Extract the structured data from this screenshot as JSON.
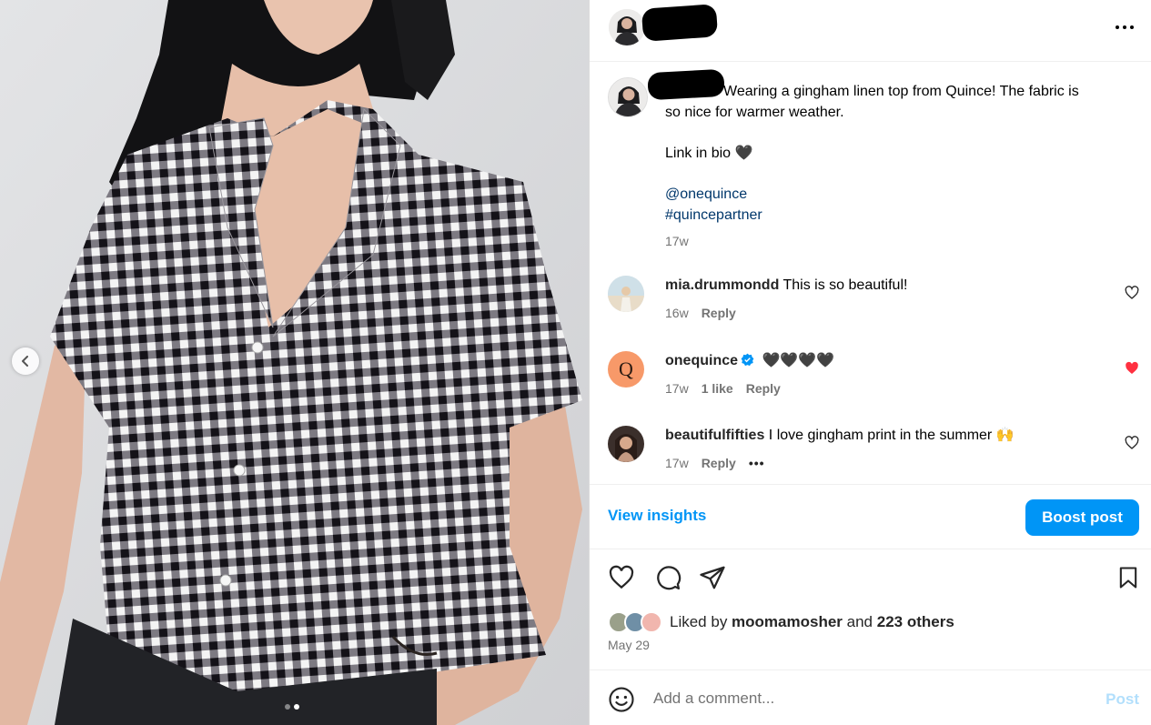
{
  "header": {
    "more_icon": "ellipsis-horizontal-icon"
  },
  "caption": {
    "lines": [
      "Wearing a gingham linen top from Quince! The fabric is",
      "so nice for warmer weather."
    ],
    "link_in_bio": "Link in bio 🖤",
    "mention": "@onequince",
    "hashtag": "#quincepartner",
    "time": "17w"
  },
  "comments": [
    {
      "username": "mia.drummondd",
      "text": "This is so beautiful!",
      "time": "16w",
      "reply": "Reply",
      "liked": false
    },
    {
      "username": "onequince",
      "verified": true,
      "text": "🖤🖤🖤🖤",
      "time": "17w",
      "likes": "1 like",
      "reply": "Reply",
      "liked": true,
      "avatar_letter": "Q"
    },
    {
      "username": "beautifulfifties",
      "text": "I love gingham print in the summer 🙌",
      "time": "17w",
      "reply": "Reply",
      "more": "•••",
      "liked": false
    }
  ],
  "insights": {
    "view_label": "View insights",
    "boost_label": "Boost post"
  },
  "likes": {
    "prefix": "Liked by ",
    "user": "moomamosher",
    "middle": " and ",
    "others": "223 others"
  },
  "date": "May 29",
  "comment_box": {
    "placeholder": "Add a comment...",
    "post_label": "Post"
  },
  "colors": {
    "accent": "#0095f6",
    "liked_heart": "#ff3040",
    "link": "#00376b",
    "quince_avatar": "#f79969"
  },
  "carousel": {
    "slide_count": 2,
    "active_slide": 2
  }
}
